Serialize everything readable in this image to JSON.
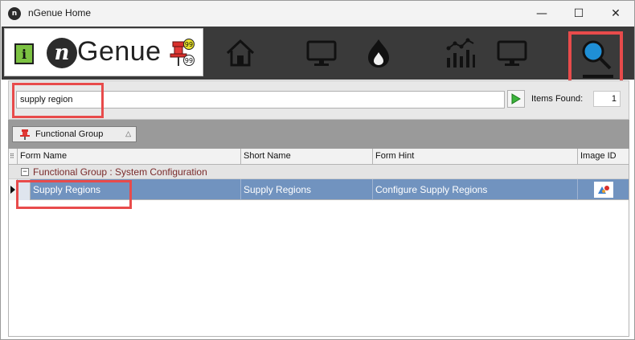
{
  "window": {
    "title": "nGenue Home",
    "app_icon_glyph": "n",
    "controls": {
      "minimize": "—",
      "maximize": "☐",
      "close": "✕"
    }
  },
  "toolbar": {
    "logo": {
      "info_glyph": "i",
      "logo_mark": "n",
      "brand": "Genue"
    },
    "pin_badges": {
      "top": "99",
      "bottom": "99"
    },
    "icons": [
      "home-icon",
      "monitor-icon",
      "flame-icon",
      "line-chart-icon",
      "monitor-icon",
      "search-icon"
    ],
    "active": "search-icon"
  },
  "search": {
    "value": "supply region",
    "items_found_label": "Items Found:",
    "items_found": "1"
  },
  "grouping": {
    "chip_label": "Functional Group",
    "sort_glyph": "△"
  },
  "grid": {
    "columns": [
      "Form Name",
      "Short Name",
      "Form Hint",
      "Image ID"
    ],
    "indicator_glyph": "⠿",
    "group_row": {
      "expander": "−",
      "label": "Functional Group : System Configuration"
    },
    "rows": [
      {
        "form_name": "Supply Regions",
        "short_name": "Supply Regions",
        "form_hint": "Configure Supply Regions",
        "image": "supply-region-icon"
      }
    ]
  },
  "colors": {
    "toolbar_bg": "#3a3a3a",
    "selected_row": "#7193bf",
    "highlight": "#e84b4b",
    "group_text": "#7a2b2b",
    "accent_search": "#1f8fd6"
  }
}
